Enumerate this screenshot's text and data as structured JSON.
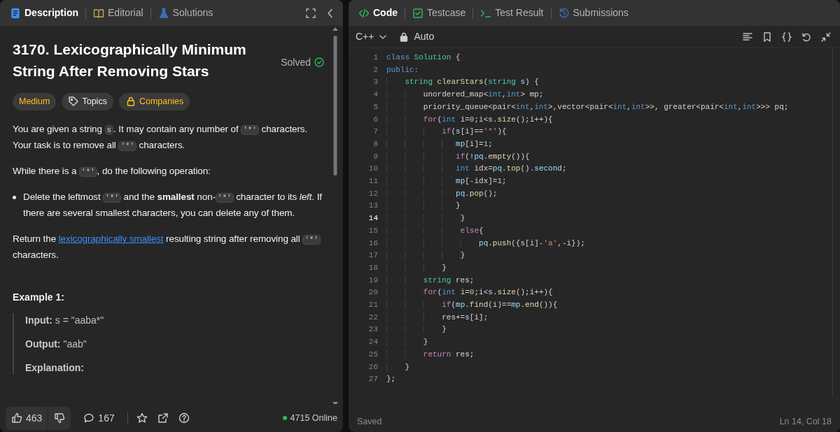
{
  "problem_panel": {
    "tabs": [
      {
        "label": "Description",
        "selected": true
      },
      {
        "label": "Editorial",
        "selected": false
      },
      {
        "label": "Solutions",
        "selected": false
      }
    ],
    "title": "3170. Lexicographically Minimum String After Removing Stars",
    "status": "Solved",
    "tags": [
      {
        "label": "Medium",
        "kind": "difficulty",
        "color": "#ffc01e"
      },
      {
        "label": "Topics",
        "kind": "topics",
        "color": "#eff1f6"
      },
      {
        "label": "Companies",
        "kind": "locked",
        "color": "#ffc01e"
      }
    ],
    "description": [
      {
        "kind": "paragraph",
        "segments": [
          {
            "kind": "text",
            "text": "You are given a string "
          },
          {
            "kind": "code",
            "text": "s"
          },
          {
            "kind": "text",
            "text": ". It may contain any number of "
          },
          {
            "kind": "code",
            "text": "'*'"
          },
          {
            "kind": "text",
            "text": " characters. Your task is to remove all "
          },
          {
            "kind": "code",
            "text": "'*'"
          },
          {
            "kind": "text",
            "text": " characters."
          }
        ]
      },
      {
        "kind": "paragraph",
        "segments": [
          {
            "kind": "text",
            "text": "While there is a "
          },
          {
            "kind": "code",
            "text": "'*'"
          },
          {
            "kind": "text",
            "text": ", do the following operation:"
          }
        ]
      },
      {
        "kind": "bullet",
        "segments": [
          {
            "kind": "text",
            "text": "Delete the leftmost "
          },
          {
            "kind": "code",
            "text": "'*'"
          },
          {
            "kind": "text",
            "text": " and the "
          },
          {
            "kind": "bold",
            "text": "smallest"
          },
          {
            "kind": "text",
            "text": " non-"
          },
          {
            "kind": "code",
            "text": "'*'"
          },
          {
            "kind": "text",
            "text": " character to its "
          },
          {
            "kind": "italic",
            "text": "left"
          },
          {
            "kind": "text",
            "text": ". If there are several smallest characters, you can delete any of them."
          }
        ]
      },
      {
        "kind": "paragraph",
        "segments": [
          {
            "kind": "text",
            "text": "Return the "
          },
          {
            "kind": "link",
            "text": "lexicographically smallest"
          },
          {
            "kind": "text",
            "text": " resulting string after removing all "
          },
          {
            "kind": "code",
            "text": "'*'"
          },
          {
            "kind": "text",
            "text": " characters."
          }
        ]
      }
    ],
    "example": {
      "heading": "Example 1:",
      "rows": [
        {
          "label": "Input:",
          "value": "s = \"aaba*\""
        },
        {
          "label": "Output:",
          "value": "\"aab\""
        },
        {
          "label": "Explanation:"
        }
      ]
    },
    "footer": {
      "likes": "463",
      "comments": "167",
      "online": "4715 Online"
    }
  },
  "editor_panel": {
    "tabs": [
      {
        "label": "Code",
        "selected": true
      },
      {
        "label": "Testcase",
        "selected": false
      },
      {
        "label": "Test Result",
        "selected": false
      },
      {
        "label": "Submissions",
        "selected": false
      }
    ],
    "language": "C++",
    "mode": "Auto",
    "lines": [
      {
        "number": "1",
        "current": false,
        "tokens": [
          {
            "kind": "keyword",
            "text": "class"
          },
          {
            "kind": "type",
            "text": " Solution"
          },
          {
            "kind": "plain",
            "text": " {"
          }
        ]
      },
      {
        "number": "2",
        "current": false,
        "tokens": [
          {
            "kind": "keyword",
            "text": "public:"
          }
        ]
      },
      {
        "number": "3",
        "current": false,
        "tokens": [
          {
            "kind": "type",
            "text": "    string"
          },
          {
            "kind": "function",
            "text": " clearStars"
          },
          {
            "kind": "plain",
            "text": "("
          },
          {
            "kind": "type",
            "text": "string"
          },
          {
            "kind": "variable",
            "text": " s"
          },
          {
            "kind": "plain",
            "text": ") {"
          }
        ]
      },
      {
        "number": "4",
        "current": false,
        "tokens": [
          {
            "kind": "plain",
            "text": "        unordered_map<"
          },
          {
            "kind": "keyword",
            "text": "int"
          },
          {
            "kind": "plain",
            "text": ","
          },
          {
            "kind": "keyword",
            "text": "int"
          },
          {
            "kind": "plain",
            "text": "> mp;"
          }
        ]
      },
      {
        "number": "5",
        "current": false,
        "tokens": [
          {
            "kind": "plain",
            "text": "        priority_queue<pair<"
          },
          {
            "kind": "keyword",
            "text": "int"
          },
          {
            "kind": "plain",
            "text": ","
          },
          {
            "kind": "keyword",
            "text": "int"
          },
          {
            "kind": "plain",
            "text": ">,vector<pair<"
          },
          {
            "kind": "keyword",
            "text": "int"
          },
          {
            "kind": "plain",
            "text": ","
          },
          {
            "kind": "keyword",
            "text": "int"
          },
          {
            "kind": "plain",
            "text": ">>, greater<pair<"
          },
          {
            "kind": "keyword",
            "text": "int"
          },
          {
            "kind": "plain",
            "text": ","
          },
          {
            "kind": "keyword",
            "text": "int"
          },
          {
            "kind": "plain",
            "text": ">>> pq;"
          }
        ]
      },
      {
        "number": "6",
        "current": false,
        "tokens": [
          {
            "kind": "control",
            "text": "        for"
          },
          {
            "kind": "plain",
            "text": "("
          },
          {
            "kind": "keyword",
            "text": "int"
          },
          {
            "kind": "plain",
            "text": " i="
          },
          {
            "kind": "number",
            "text": "0"
          },
          {
            "kind": "plain",
            "text": ";i<"
          },
          {
            "kind": "variable",
            "text": "s"
          },
          {
            "kind": "plain",
            "text": "."
          },
          {
            "kind": "function",
            "text": "size"
          },
          {
            "kind": "plain",
            "text": "();i++){"
          }
        ]
      },
      {
        "number": "7",
        "current": false,
        "tokens": [
          {
            "kind": "control",
            "text": "            if"
          },
          {
            "kind": "plain",
            "text": "("
          },
          {
            "kind": "variable",
            "text": "s"
          },
          {
            "kind": "plain",
            "text": "[i]=="
          },
          {
            "kind": "string",
            "text": "'*'"
          },
          {
            "kind": "plain",
            "text": "){"
          }
        ]
      },
      {
        "number": "8",
        "current": false,
        "tokens": [
          {
            "kind": "variable",
            "text": "               mp"
          },
          {
            "kind": "plain",
            "text": "[i]="
          },
          {
            "kind": "number",
            "text": "1"
          },
          {
            "kind": "plain",
            "text": ";"
          }
        ]
      },
      {
        "number": "9",
        "current": false,
        "tokens": [
          {
            "kind": "control",
            "text": "               if"
          },
          {
            "kind": "plain",
            "text": "(!"
          },
          {
            "kind": "variable",
            "text": "pq"
          },
          {
            "kind": "plain",
            "text": "."
          },
          {
            "kind": "function",
            "text": "empty"
          },
          {
            "kind": "plain",
            "text": "()){"
          }
        ]
      },
      {
        "number": "10",
        "current": false,
        "tokens": [
          {
            "kind": "keyword",
            "text": "               int"
          },
          {
            "kind": "plain",
            "text": " idx="
          },
          {
            "kind": "variable",
            "text": "pq"
          },
          {
            "kind": "plain",
            "text": "."
          },
          {
            "kind": "function",
            "text": "top"
          },
          {
            "kind": "plain",
            "text": "()."
          },
          {
            "kind": "variable",
            "text": "second"
          },
          {
            "kind": "plain",
            "text": ";"
          }
        ]
      },
      {
        "number": "11",
        "current": false,
        "tokens": [
          {
            "kind": "variable",
            "text": "               mp"
          },
          {
            "kind": "plain",
            "text": "[-idx]="
          },
          {
            "kind": "number",
            "text": "1"
          },
          {
            "kind": "plain",
            "text": ";"
          }
        ]
      },
      {
        "number": "12",
        "current": false,
        "tokens": [
          {
            "kind": "variable",
            "text": "               pq"
          },
          {
            "kind": "plain",
            "text": "."
          },
          {
            "kind": "function",
            "text": "pop"
          },
          {
            "kind": "plain",
            "text": "();"
          }
        ]
      },
      {
        "number": "13",
        "current": false,
        "tokens": [
          {
            "kind": "plain",
            "text": "               }"
          }
        ]
      },
      {
        "number": "14",
        "current": true,
        "tokens": [
          {
            "kind": "plain",
            "text": "                }"
          }
        ]
      },
      {
        "number": "15",
        "current": false,
        "tokens": [
          {
            "kind": "control",
            "text": "                else"
          },
          {
            "kind": "plain",
            "text": "{"
          }
        ]
      },
      {
        "number": "16",
        "current": false,
        "tokens": [
          {
            "kind": "variable",
            "text": "                    pq"
          },
          {
            "kind": "plain",
            "text": "."
          },
          {
            "kind": "function",
            "text": "push"
          },
          {
            "kind": "plain",
            "text": "({"
          },
          {
            "kind": "variable",
            "text": "s"
          },
          {
            "kind": "plain",
            "text": "[i]-"
          },
          {
            "kind": "string",
            "text": "'a'"
          },
          {
            "kind": "plain",
            "text": ",-i});"
          }
        ]
      },
      {
        "number": "17",
        "current": false,
        "tokens": [
          {
            "kind": "plain",
            "text": "                }"
          }
        ]
      },
      {
        "number": "18",
        "current": false,
        "tokens": [
          {
            "kind": "plain",
            "text": "            }"
          }
        ]
      },
      {
        "number": "19",
        "current": false,
        "tokens": [
          {
            "kind": "type",
            "text": "        string"
          },
          {
            "kind": "plain",
            "text": " res;"
          }
        ]
      },
      {
        "number": "20",
        "current": false,
        "tokens": [
          {
            "kind": "control",
            "text": "        for"
          },
          {
            "kind": "plain",
            "text": "("
          },
          {
            "kind": "keyword",
            "text": "int"
          },
          {
            "kind": "plain",
            "text": " i="
          },
          {
            "kind": "number",
            "text": "0"
          },
          {
            "kind": "plain",
            "text": ";i<"
          },
          {
            "kind": "variable",
            "text": "s"
          },
          {
            "kind": "plain",
            "text": "."
          },
          {
            "kind": "function",
            "text": "size"
          },
          {
            "kind": "plain",
            "text": "();i++){"
          }
        ]
      },
      {
        "number": "21",
        "current": false,
        "tokens": [
          {
            "kind": "control",
            "text": "            if"
          },
          {
            "kind": "plain",
            "text": "("
          },
          {
            "kind": "variable",
            "text": "mp"
          },
          {
            "kind": "plain",
            "text": "."
          },
          {
            "kind": "function",
            "text": "find"
          },
          {
            "kind": "plain",
            "text": "(i)=="
          },
          {
            "kind": "variable",
            "text": "mp"
          },
          {
            "kind": "plain",
            "text": "."
          },
          {
            "kind": "function",
            "text": "end"
          },
          {
            "kind": "plain",
            "text": "()){"
          }
        ]
      },
      {
        "number": "22",
        "current": false,
        "tokens": [
          {
            "kind": "plain",
            "text": "            res+="
          },
          {
            "kind": "variable",
            "text": "s"
          },
          {
            "kind": "plain",
            "text": "[i];"
          }
        ]
      },
      {
        "number": "23",
        "current": false,
        "tokens": [
          {
            "kind": "plain",
            "text": "            }"
          }
        ]
      },
      {
        "number": "24",
        "current": false,
        "tokens": [
          {
            "kind": "plain",
            "text": "        }"
          }
        ]
      },
      {
        "number": "25",
        "current": false,
        "tokens": [
          {
            "kind": "control",
            "text": "        return"
          },
          {
            "kind": "plain",
            "text": " res;"
          }
        ]
      },
      {
        "number": "26",
        "current": false,
        "tokens": [
          {
            "kind": "plain",
            "text": "    }"
          }
        ]
      },
      {
        "number": "27",
        "current": false,
        "tokens": [
          {
            "kind": "plain",
            "text": "};"
          }
        ]
      }
    ],
    "status_bar": {
      "saved": "Saved",
      "cursor": "Ln 14, Col 18"
    }
  }
}
